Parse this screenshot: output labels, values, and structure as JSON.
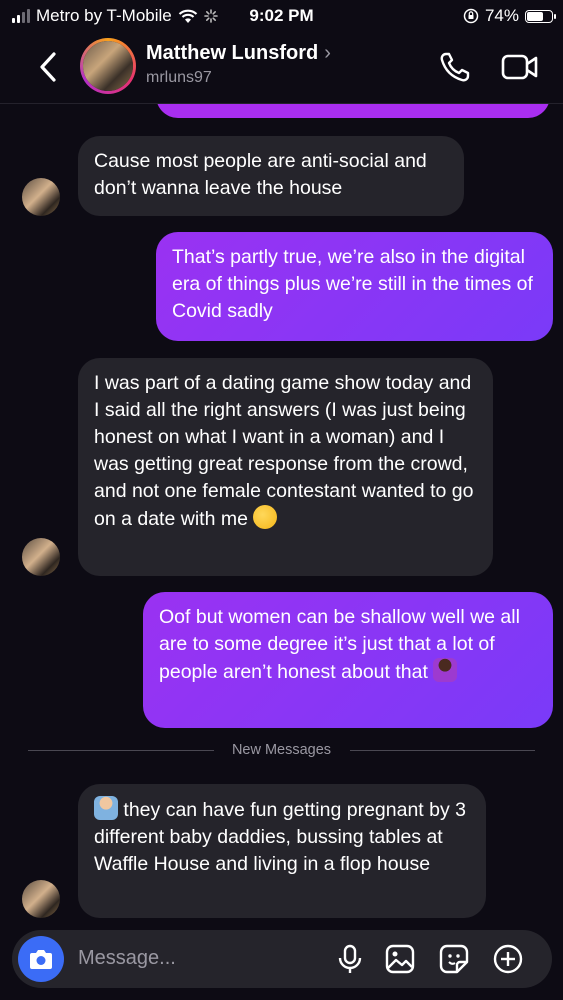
{
  "status_bar": {
    "carrier": "Metro by T-Mobile",
    "time": "9:02 PM",
    "battery": "74%",
    "battery_level": 0.74
  },
  "header": {
    "contact_name": "Matthew Lunsford",
    "chevron": "›",
    "username": "mrluns97",
    "icons": [
      "back-chevron-icon",
      "phone-icon",
      "video-camera-icon"
    ]
  },
  "messages": [
    {
      "from": "them",
      "text": "Cause most people are anti-social and don’t wanna leave the house"
    },
    {
      "from": "me",
      "text": "That’s partly true, we’re also in the digital era of things plus we’re still in the times of Covid sadly"
    },
    {
      "from": "them",
      "text": "I was part of a dating game show today and I said all the right answers (I was just being honest on what I want in a woman) and I was getting great response from the crowd, and not one female contestant wanted to go on a date with me",
      "emoji": "hugging-face"
    },
    {
      "from": "me",
      "text": "Oof but women can be shallow well we all are to some degree it’s just that a lot of people aren’t honest about that",
      "emoji": "woman-shrugging"
    },
    {
      "from": "them",
      "text": "they can have fun getting pregnant by 3 different baby daddies, bussing tables at Waffle House and living in a flop house",
      "emoji": "man-shrugging"
    }
  ],
  "divider": {
    "label": "New Messages"
  },
  "composer": {
    "placeholder": "Message...",
    "icons": [
      "camera-icon",
      "microphone-icon",
      "gallery-icon",
      "sticker-icon",
      "plus-icon"
    ]
  },
  "colors": {
    "background": "#0d0b14",
    "received_bubble": "#25242b",
    "sent_bubble": "#9a32f2",
    "camera_button": "#3b6cf6"
  }
}
